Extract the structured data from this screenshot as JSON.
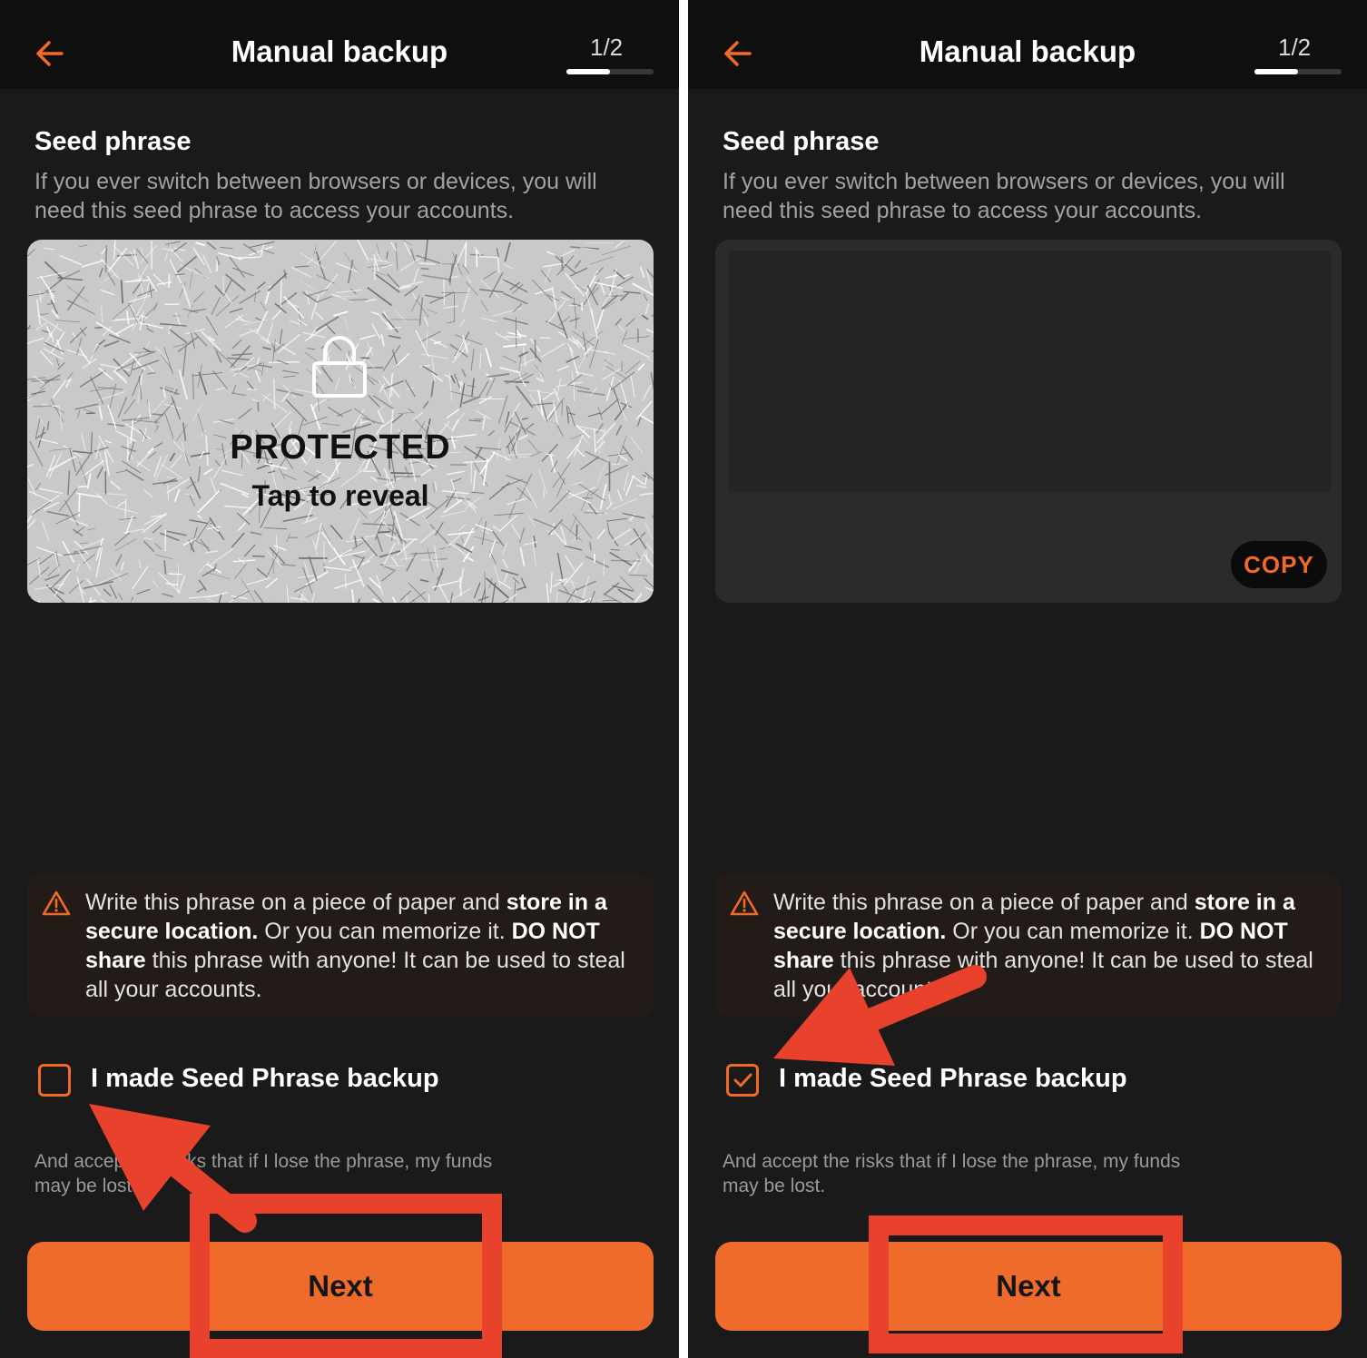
{
  "colors": {
    "accent": "#f26a25",
    "annotation_red": "#e8412c",
    "background": "#1a1a1b"
  },
  "panels": [
    {
      "header": {
        "title": "Manual backup",
        "step": "1/2",
        "progress_fraction": 0.5
      },
      "section": {
        "title": "Seed phrase",
        "description": "If you ever switch between browsers or devices, you will need this seed phrase to access your accounts."
      },
      "seed_box": {
        "state": "protected",
        "protected_label": "PROTECTED",
        "reveal_label": "Tap to reveal"
      },
      "warning": {
        "t1": "Write this phrase on a piece of paper and ",
        "b1": "store in a secure location.",
        "t2": " Or you can memorize it. ",
        "b2": "DO NOT share",
        "t3": " this phrase with anyone! It can be used to steal all your accounts."
      },
      "checkbox": {
        "label": "I made Seed Phrase backup",
        "checked": false
      },
      "accept_text": "And accept the risks that if I lose the phrase, my funds may be lost.",
      "next_label": "Next"
    },
    {
      "header": {
        "title": "Manual backup",
        "step": "1/2",
        "progress_fraction": 0.5
      },
      "section": {
        "title": "Seed phrase",
        "description": "If you ever switch between browsers or devices, you will need this seed phrase to access your accounts."
      },
      "seed_box": {
        "state": "revealed",
        "copy_label": "COPY"
      },
      "warning": {
        "t1": "Write this phrase on a piece of paper and ",
        "b1": "store in a secure location.",
        "t2": " Or you can memorize it. ",
        "b2": "DO NOT share",
        "t3": " this phrase with anyone! It can be used to steal all your accounts."
      },
      "checkbox": {
        "label": "I made Seed Phrase backup",
        "checked": true
      },
      "accept_text": "And accept the risks that if I lose the phrase, my funds may be lost.",
      "next_label": "Next"
    }
  ]
}
